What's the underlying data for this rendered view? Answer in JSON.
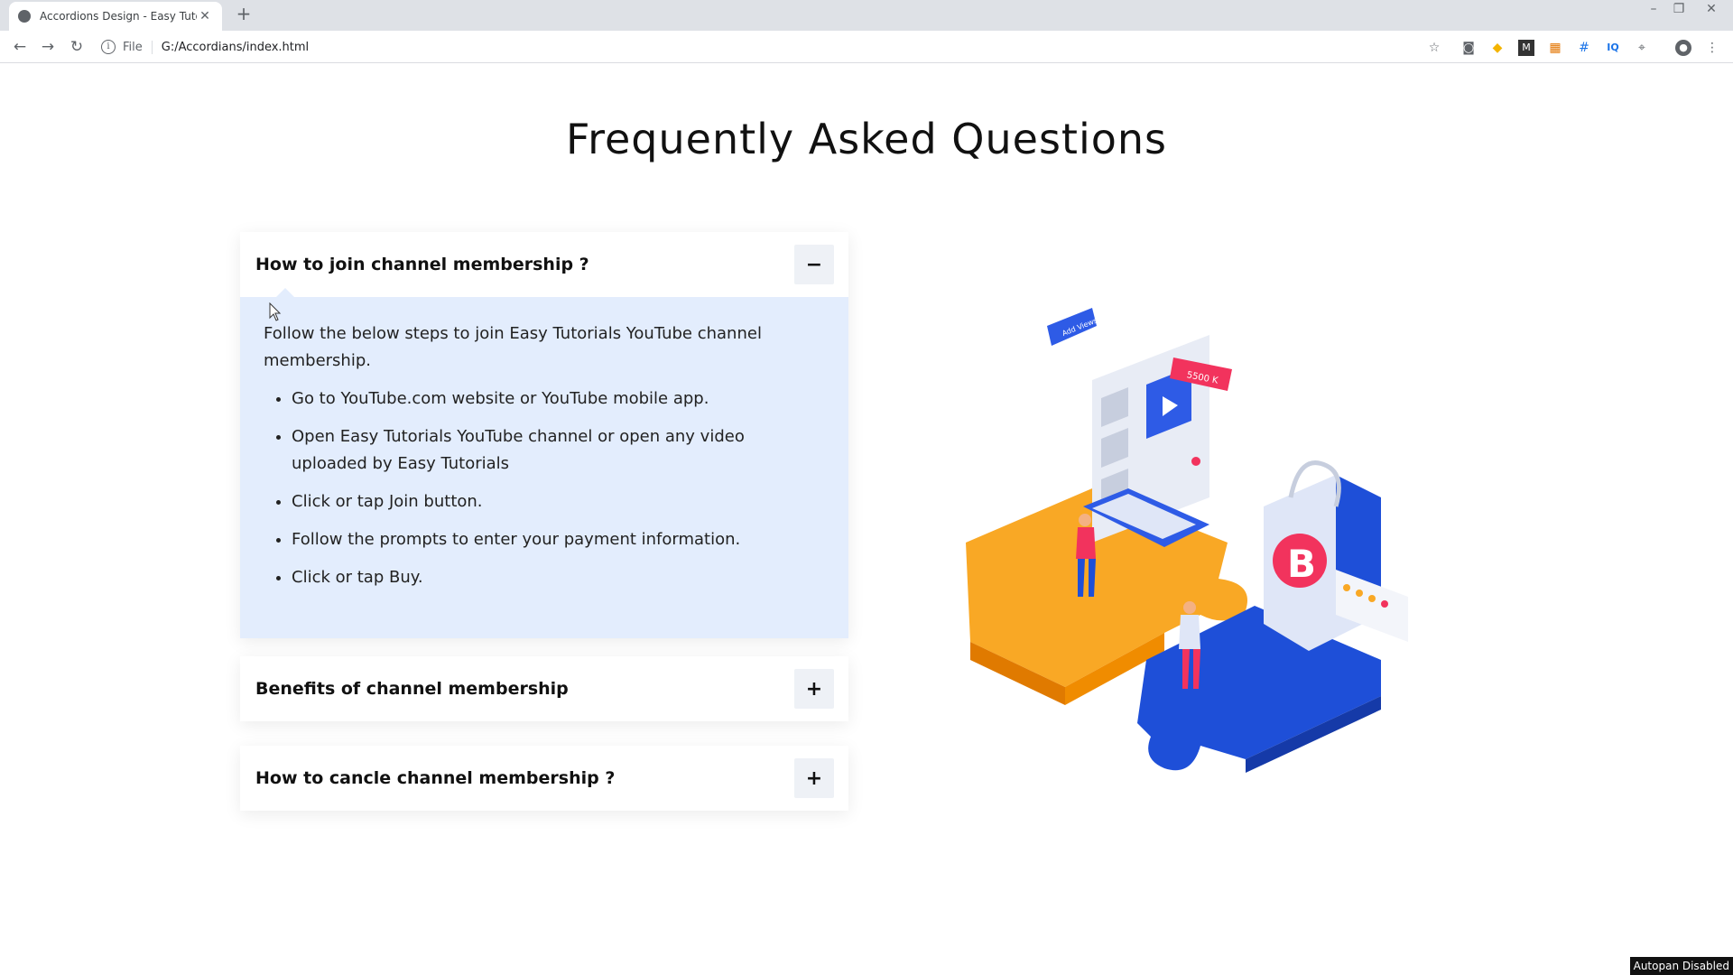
{
  "browser": {
    "tab_title": "Accordions Design - Easy Tutorials",
    "url_scheme": "File",
    "url": "G:/Accordians/index.html"
  },
  "page": {
    "heading": "Frequently Asked Questions",
    "faq": [
      {
        "question": "How to join channel membership ?",
        "expanded": true,
        "toggle": "−",
        "intro": "Follow the below steps to join Easy Tutorials YouTube channel membership.",
        "steps": [
          "Go to YouTube.com website or YouTube mobile app.",
          "Open Easy Tutorials YouTube channel or open any video uploaded by Easy Tutorials",
          "Click or tap Join button.",
          "Follow the prompts to enter your payment information.",
          "Click or tap Buy."
        ]
      },
      {
        "question": "Benefits of channel membership",
        "expanded": false,
        "toggle": "+"
      },
      {
        "question": "How to cancle channel membership ?",
        "expanded": false,
        "toggle": "+"
      }
    ],
    "illustration": {
      "badge_views": "Add Views",
      "badge_subs": "5500 K",
      "logo_letter": "B",
      "colors": {
        "yellow": "#f9a825",
        "blue": "#1e4fd8",
        "pink": "#f2335d",
        "light": "#e8ecf5"
      }
    }
  },
  "status_text": "Autopan Disabled"
}
